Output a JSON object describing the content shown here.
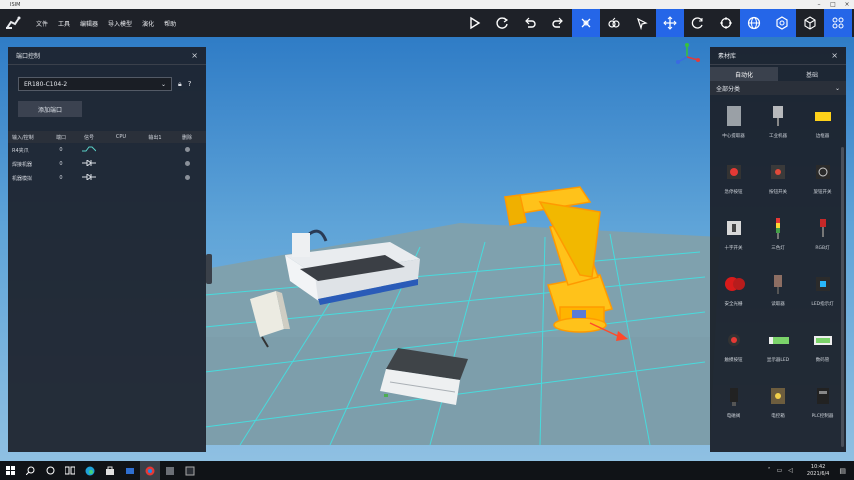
{
  "window": {
    "title": "ISIM"
  },
  "menu": [
    {
      "id": "file",
      "label": "文件"
    },
    {
      "id": "tools",
      "label": "工具"
    },
    {
      "id": "editor",
      "label": "编辑器"
    },
    {
      "id": "import",
      "label": "导入模型"
    },
    {
      "id": "sim",
      "label": "演化"
    },
    {
      "id": "help",
      "label": "帮助"
    }
  ],
  "toolbar": {
    "left_tools": [
      "play-icon",
      "refresh-icon",
      "undo-icon",
      "redo-icon"
    ],
    "right_tools": [
      "select-icon",
      "robot-icon",
      "pointer-icon",
      "move-icon",
      "rotate-icon",
      "target-icon",
      "globe-icon",
      "settings-icon",
      "cube-icon",
      "grid-icon"
    ],
    "accent": "#2566e8"
  },
  "left_panel": {
    "title": "端口控制",
    "robot_select": "ER180-C104-2",
    "add_button": "添加端口",
    "columns": [
      "输入/控制",
      "端口",
      "信号",
      "CPU",
      "输出1",
      "删除"
    ],
    "rows": [
      {
        "name": "R4夹爪",
        "port": "0",
        "signal": "square-wave-icon"
      },
      {
        "name": "焊接机器",
        "port": "0",
        "signal": "diode-icon"
      },
      {
        "name": "机器模拟",
        "port": "0",
        "signal": "diode-icon"
      }
    ]
  },
  "right_panel": {
    "title": "素材库",
    "tabs": [
      "自动化",
      "基础"
    ],
    "active_tab": 0,
    "category": "全部分类",
    "components": [
      {
        "label": "中心提取器",
        "icon": "grey-box"
      },
      {
        "label": "工业机器",
        "icon": "sensor"
      },
      {
        "label": "边框器",
        "icon": "yellow-box"
      },
      {
        "label": "急停按钮",
        "icon": "stop-button"
      },
      {
        "label": "按钮开关",
        "icon": "switch-box"
      },
      {
        "label": "旋钮开关",
        "icon": "knob-box"
      },
      {
        "label": "十字开关",
        "icon": "cross-switch"
      },
      {
        "label": "三色灯",
        "icon": "tower-light"
      },
      {
        "label": "RGB灯",
        "icon": "rgb-light"
      },
      {
        "label": "安全光栅",
        "icon": "red-gripper"
      },
      {
        "label": "读取器",
        "icon": "reader"
      },
      {
        "label": "LED指示灯",
        "icon": "led-panel"
      },
      {
        "label": "触摸按钮",
        "icon": "touch-button"
      },
      {
        "label": "显示器LED",
        "icon": "green-display"
      },
      {
        "label": "数码管",
        "icon": "digit-display"
      },
      {
        "label": "电磁阀",
        "icon": "valve"
      },
      {
        "label": "电控箱",
        "icon": "control-box"
      },
      {
        "label": "PLC控制器",
        "icon": "plc"
      }
    ]
  },
  "taskbar": {
    "time": "10:42",
    "date": "2021/6/4",
    "apps": [
      "start-icon",
      "search-icon",
      "taskview-icon",
      "edge-icon",
      "store-icon",
      "mail-icon",
      "chrome-icon",
      "app-icon",
      "isim-icon"
    ]
  }
}
